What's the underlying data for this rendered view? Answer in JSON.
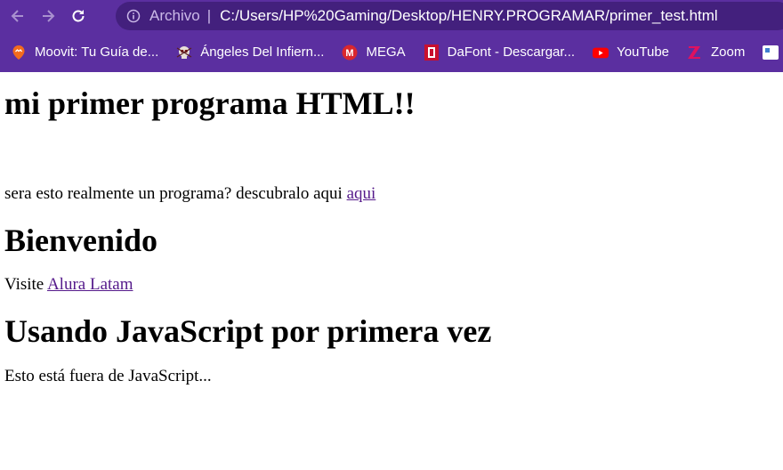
{
  "browser": {
    "address_bar": {
      "scheme_label": "Archivo",
      "separator": "|",
      "url": "C:/Users/HP%20Gaming/Desktop/HENRY.PROGRAMAR/primer_test.html"
    },
    "bookmarks": [
      {
        "label": "Moovit: Tu Guía de...",
        "icon": "moovit-icon"
      },
      {
        "label": "Ángeles Del Infiern...",
        "icon": "skull-icon"
      },
      {
        "label": "MEGA",
        "icon": "mega-icon"
      },
      {
        "label": "DaFont - Descargar...",
        "icon": "dafont-icon"
      },
      {
        "label": "YouTube",
        "icon": "youtube-icon"
      },
      {
        "label": "Zoom",
        "icon": "zoom-icon"
      }
    ],
    "colors": {
      "chrome": "#5b2fa0",
      "omnibox": "#43207d"
    }
  },
  "page": {
    "title": "mi primer programa HTML!!",
    "line1_text": "sera esto realmente un programa? descubralo aqui ",
    "line1_link": "aqui",
    "heading2": "Bienvenido",
    "visit_text": "Visite ",
    "visit_link": "Alura Latam",
    "heading3": "Usando JavaScript por primera vez",
    "footer_text": "Esto está fuera de JavaScript...",
    "link_color": "#551a8b"
  }
}
